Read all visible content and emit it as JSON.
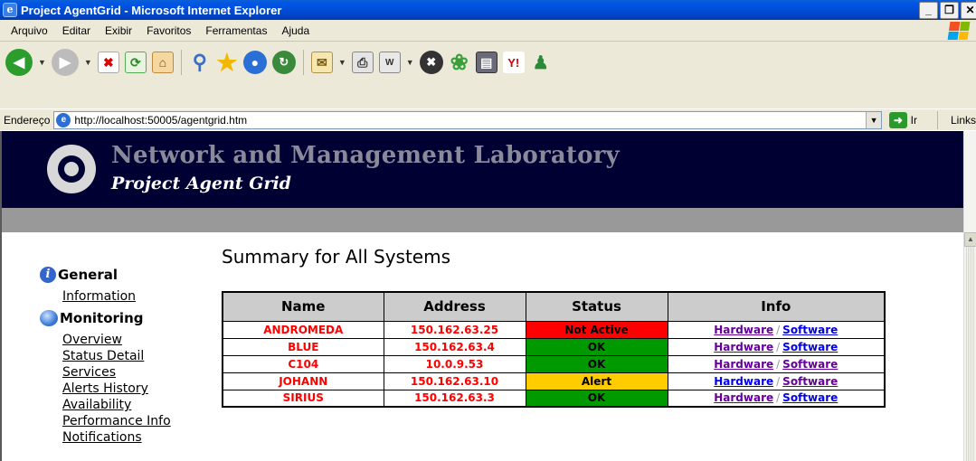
{
  "window": {
    "title": "Project AgentGrid - Microsoft Internet Explorer",
    "controls": [
      "_",
      "❒",
      "✕"
    ]
  },
  "menu": [
    "Arquivo",
    "Editar",
    "Exibir",
    "Favoritos",
    "Ferramentas",
    "Ajuda"
  ],
  "address": {
    "label": "Endereço",
    "url": "http://localhost:50005/agentgrid.htm",
    "go_label": "Ir",
    "links_label": "Links"
  },
  "banner": {
    "title": "Network and Management Laboratory",
    "subtitle": "Project Agent Grid"
  },
  "sidebar": {
    "general": {
      "label": "General",
      "items": [
        "Information"
      ]
    },
    "monitoring": {
      "label": "Monitoring",
      "items": [
        "Overview",
        "Status Detail",
        "Services",
        "Alerts History",
        "Availability",
        "Performance Info",
        "Notifications"
      ]
    }
  },
  "main": {
    "title": "Summary for All Systems",
    "columns": [
      "Name",
      "Address",
      "Status",
      "Info"
    ],
    "rows": [
      {
        "name": "ANDROMEDA",
        "address": "150.162.63.25",
        "status": "Not Active",
        "status_color": "#ff0000",
        "hw": "Hardware",
        "sw": "Software"
      },
      {
        "name": "BLUE",
        "address": "150.162.63.4",
        "status": "OK",
        "status_color": "#009900",
        "hw": "Hardware",
        "sw": "Software"
      },
      {
        "name": "C104",
        "address": "10.0.9.53",
        "status": "OK",
        "status_color": "#009900",
        "hw": "Hardware",
        "sw": "Software"
      },
      {
        "name": "JOHANN",
        "address": "150.162.63.10",
        "status": "Alert",
        "status_color": "#ffcc00",
        "hw": "Hardware",
        "sw": "Software"
      },
      {
        "name": "SIRIUS",
        "address": "150.162.63.3",
        "status": "OK",
        "status_color": "#009900",
        "hw": "Hardware",
        "sw": "Software"
      }
    ]
  }
}
